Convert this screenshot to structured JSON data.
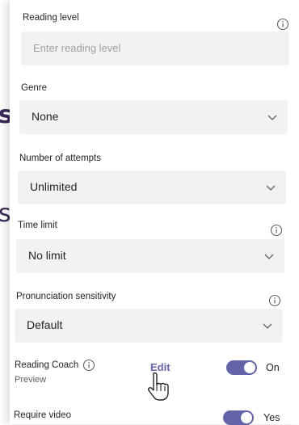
{
  "background": {
    "letter_s_bold": "s",
    "letter_s_light": "s"
  },
  "colors": {
    "accent": "#6264a7",
    "field_bg": "#f3f2f1",
    "text": "#252423",
    "placeholder": "#a19f9d"
  },
  "reading_level": {
    "label": "Reading level",
    "placeholder": "Enter reading level",
    "info_icon": "info-circle-icon"
  },
  "genre": {
    "label": "Genre",
    "value": "None",
    "icon": "chevron-down-icon"
  },
  "attempts": {
    "label": "Number of attempts",
    "value": "Unlimited",
    "icon": "chevron-down-icon"
  },
  "time_limit": {
    "label": "Time limit",
    "value": "No limit",
    "icon": "chevron-down-icon",
    "info_icon": "info-circle-icon"
  },
  "sensitivity": {
    "label": "Pronunciation sensitivity",
    "value": "Default",
    "icon": "chevron-down-icon",
    "info_icon": "info-circle-icon"
  },
  "reading_coach": {
    "label": "Reading Coach",
    "sublabel": "Preview",
    "edit_label": "Edit",
    "toggle_on": true,
    "toggle_text": "On",
    "info_icon": "info-circle-icon",
    "cursor_icon": "hand-pointer-icon"
  },
  "require_video": {
    "label": "Require video",
    "toggle_on": true,
    "toggle_text": "Yes"
  }
}
